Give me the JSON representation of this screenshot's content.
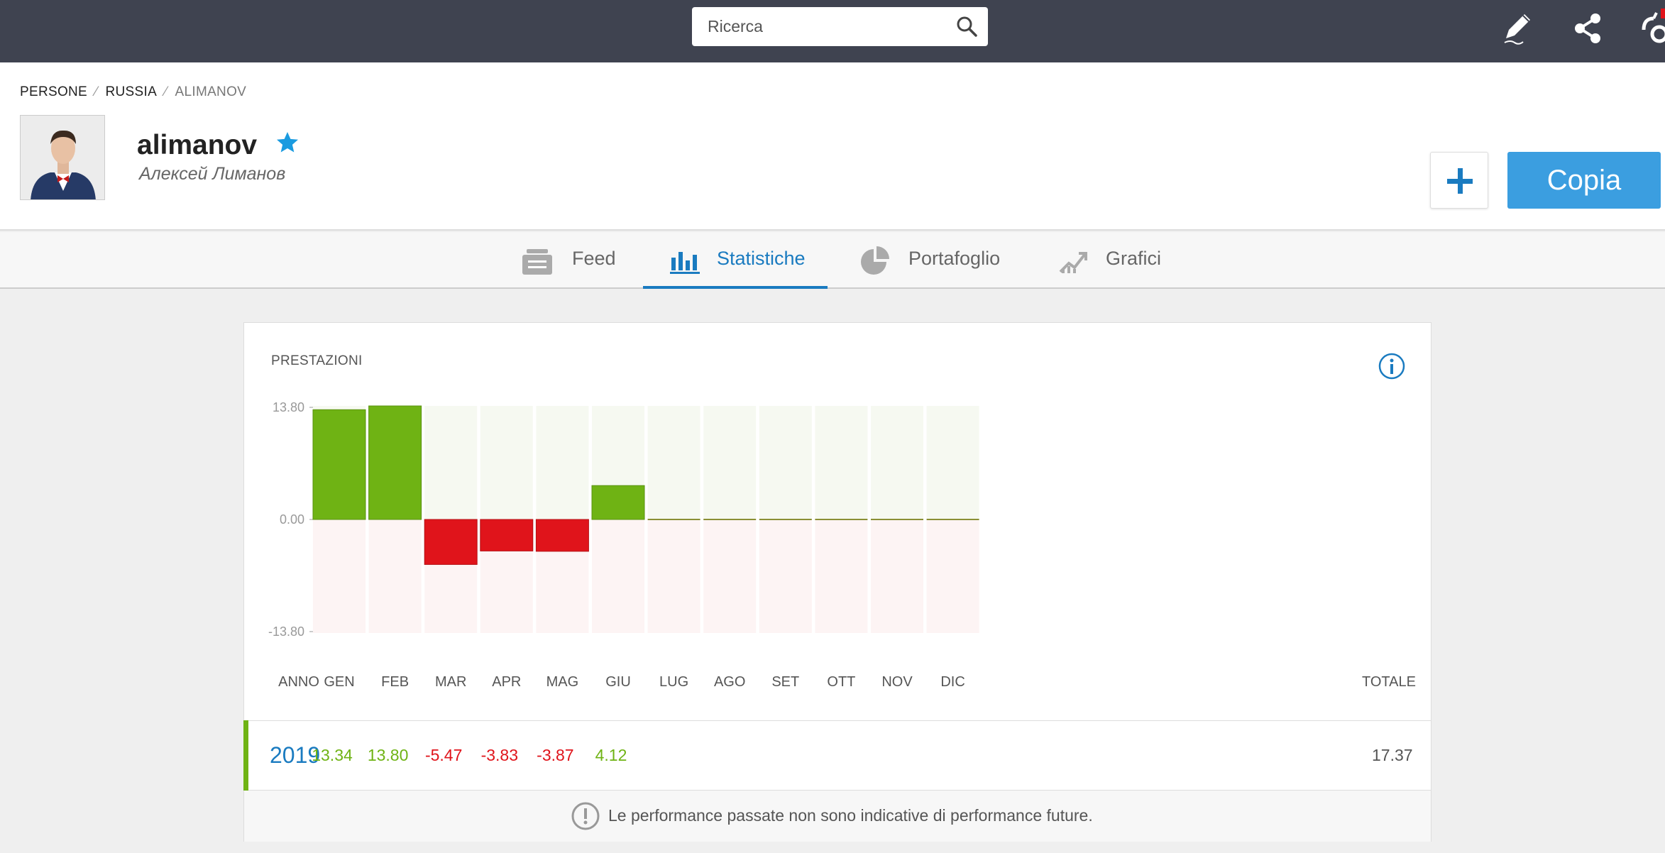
{
  "search": {
    "placeholder": "Ricerca"
  },
  "top_icons": [
    "pencil-icon",
    "share-icon",
    "brand-logo-icon"
  ],
  "breadcrumb": [
    "PERSONE",
    "RUSSIA",
    "ALIMANOV"
  ],
  "profile": {
    "username": "alimanov",
    "real_name": "Алексей Лиманов"
  },
  "buttons": {
    "add": "+",
    "copy": "Copia"
  },
  "tabs": [
    {
      "label": "Feed",
      "icon": "feed-icon",
      "active": false
    },
    {
      "label": "Statistiche",
      "icon": "bar-chart-icon",
      "active": true
    },
    {
      "label": "Portafoglio",
      "icon": "pie-chart-icon",
      "active": false
    },
    {
      "label": "Grafici",
      "icon": "trend-chart-icon",
      "active": false
    }
  ],
  "card": {
    "title": "PRESTAZIONI",
    "disclaimer": "Le performance passate non sono indicative di performance future."
  },
  "colors": {
    "positive": "#6fb314",
    "negative": "#e0141b",
    "accent": "#1a7bc0",
    "topbar": "#3f4350",
    "copy_button": "#3b9ee0"
  },
  "chart_data": {
    "type": "bar",
    "title": "PRESTAZIONI",
    "categories": [
      "GEN",
      "FEB",
      "MAR",
      "APR",
      "MAG",
      "GIU",
      "LUG",
      "AGO",
      "SET",
      "OTT",
      "NOV",
      "DIC"
    ],
    "values": [
      13.34,
      13.8,
      -5.47,
      -3.83,
      -3.87,
      4.12,
      0,
      0,
      0,
      0,
      0,
      0
    ],
    "y_ticks": [
      "13.80",
      "0.00",
      "-13.80"
    ],
    "ylim": [
      -13.8,
      13.8
    ],
    "grid": false
  },
  "table": {
    "headers": {
      "year": "ANNO",
      "total": "TOTALE"
    },
    "rows": [
      {
        "year": "2019",
        "values": [
          "13.34",
          "13.80",
          "-5.47",
          "-3.83",
          "-3.87",
          "4.12",
          "",
          "",
          "",
          "",
          "",
          ""
        ],
        "total": "17.37"
      }
    ]
  }
}
